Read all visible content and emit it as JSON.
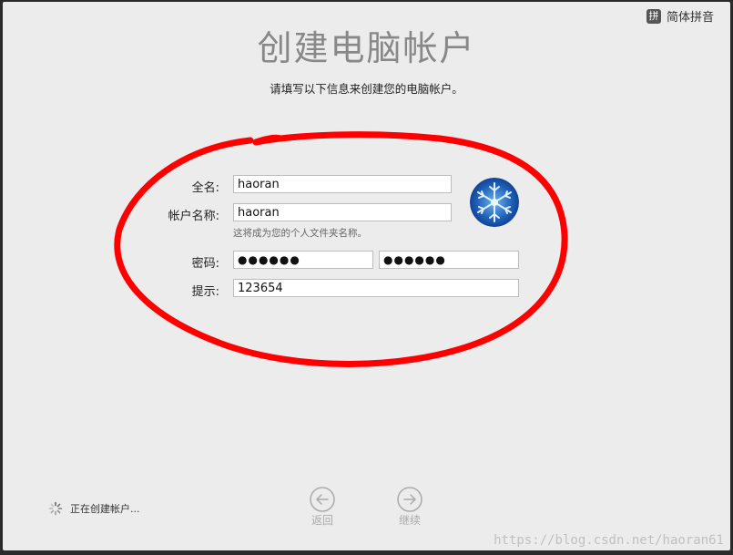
{
  "ime": {
    "badge": "拼",
    "label": "简体拼音"
  },
  "header": {
    "title": "创建电脑帐户",
    "subtitle": "请填写以下信息来创建您的电脑帐户。"
  },
  "form": {
    "fullname_label": "全名:",
    "fullname_value": "haoran",
    "account_label": "帐户名称:",
    "account_value": "haoran",
    "account_hint": "这将成为您的个人文件夹名称。",
    "password_label": "密码:",
    "password_value": "●●●●●●",
    "verify_value": "●●●●●●",
    "hint_label": "提示:",
    "hint_value": "123654"
  },
  "status": {
    "text": "正在创建帐户..."
  },
  "nav": {
    "back_label": "返回",
    "continue_label": "继续"
  },
  "watermark": "https://blog.csdn.net/haoran61",
  "colors": {
    "annotation": "#ff0000",
    "background": "#ececec",
    "title": "#888888"
  }
}
